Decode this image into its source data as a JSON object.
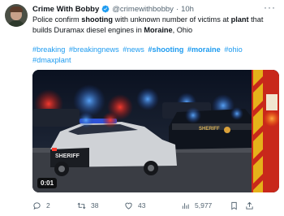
{
  "author": {
    "name": "Crime With Bobby",
    "handle": "@crimewithbobby",
    "separator": "·",
    "time": "10h"
  },
  "tweet": {
    "segments": [
      {
        "text": "Police confirm ",
        "bold": false
      },
      {
        "text": "shooting",
        "bold": true
      },
      {
        "text": " with unknown number of victims at ",
        "bold": false
      },
      {
        "text": "plant",
        "bold": true
      },
      {
        "text": " that builds Duramax diesel engines in ",
        "bold": false
      },
      {
        "text": "Moraine",
        "bold": true
      },
      {
        "text": ", Ohio",
        "bold": false
      }
    ],
    "hashtags": [
      "#breaking",
      "#breakingnews",
      "#news",
      "#shooting",
      "#moraine",
      "#ohio",
      "#dmaxplant"
    ],
    "bold_hashtags": [
      "#shooting",
      "#moraine"
    ]
  },
  "media": {
    "duration": "0:01",
    "car_text": [
      "SHERIFF",
      "SHERIFF"
    ]
  },
  "actions": {
    "replies": "2",
    "retweets": "38",
    "likes": "43",
    "views": "5,977"
  },
  "colors": {
    "link": "#1d9bf0",
    "muted": "#536471",
    "verified": "#1d9bf0"
  },
  "icons": [
    "verified-badge-icon",
    "more-icon",
    "reply-icon",
    "retweet-icon",
    "like-icon",
    "views-icon",
    "bookmark-icon",
    "share-icon"
  ]
}
